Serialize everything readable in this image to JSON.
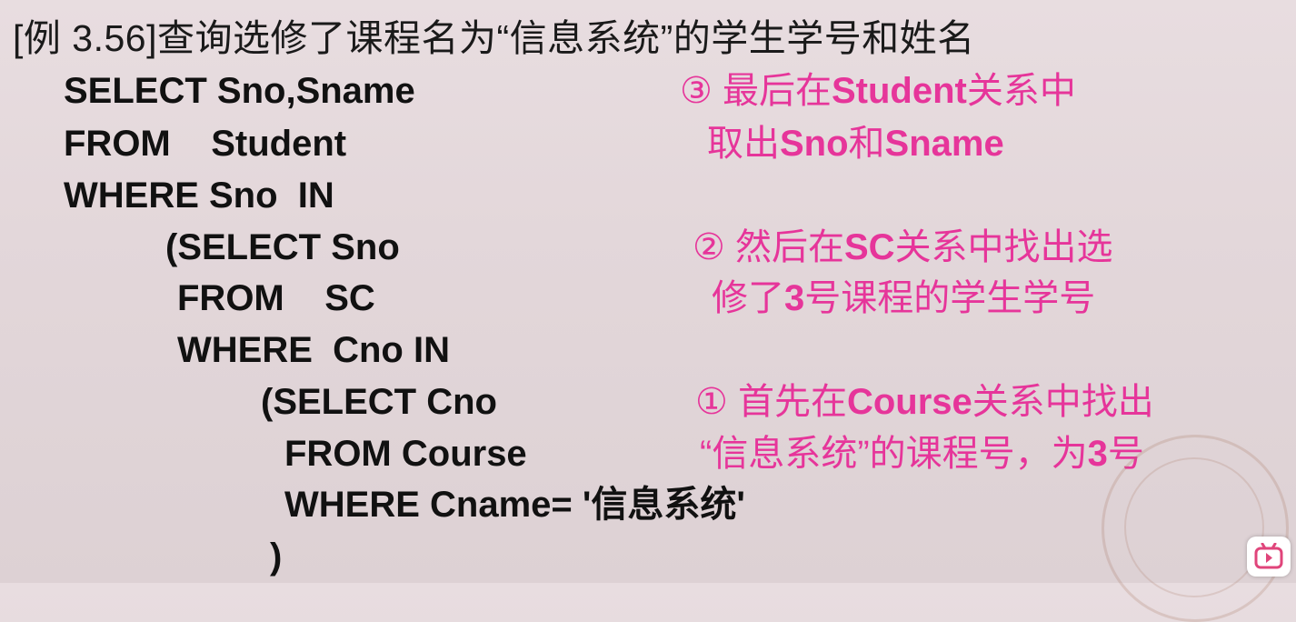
{
  "slide": {
    "title": "[例 3.56]查询选修了课程名为“信息系统”的学生学号和姓名",
    "code_lines": [
      "SELECT Sno,Sname",
      "FROM    Student",
      "WHERE Sno  IN",
      "(SELECT Sno",
      "FROM    SC",
      "WHERE  Cno IN",
      "(SELECT Cno",
      "FROM Course",
      "WHERE Cname= '信息系统'",
      ")"
    ],
    "notes": {
      "n3": {
        "l1a": "③ 最后在",
        "l1b": "Student",
        "l1c": "关系中",
        "l2a": "取出",
        "l2b": "Sno",
        "l2c": "和",
        "l2d": "Sname"
      },
      "n2": {
        "l1a": "② 然后在",
        "l1b": "SC",
        "l1c": "关系中找出选",
        "l2a": "修了",
        "l2b": "3",
        "l2c": "号课程的学生学号"
      },
      "n1": {
        "l1a": "① 首先在",
        "l1b": "Course",
        "l1c": "关系中找出",
        "l2a": "“信息系统”的课程号，为",
        "l2b": "3",
        "l2c": "号"
      }
    }
  },
  "colors": {
    "note": "#e6359a",
    "code": "#111111"
  },
  "player": {
    "icon": "bilibili-play-icon"
  }
}
